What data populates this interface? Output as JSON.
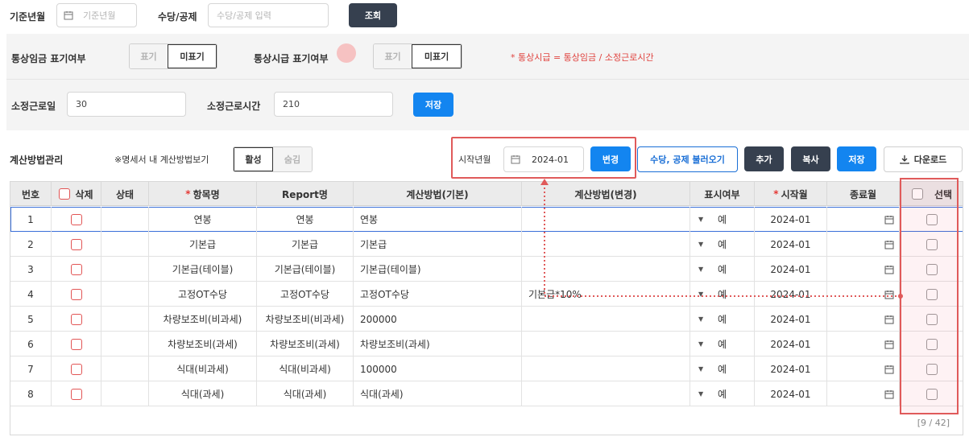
{
  "search": {
    "base_month_label": "기준년월",
    "base_month_placeholder": "기준년월",
    "allowance_label": "수당/공제",
    "allowance_placeholder": "수당/공제 입력",
    "search_button": "조회"
  },
  "display_options": {
    "normal_wage_label": "통상임금 표기여부",
    "normal_hourly_label": "통상시급 표기여부",
    "show": "표기",
    "hide": "미표기",
    "formula_note": "* 통상시급 = 통상임금 / 소정근로시간"
  },
  "work": {
    "days_label": "소정근로일",
    "days_value": "30",
    "hours_label": "소정근로시간",
    "hours_value": "210",
    "save_button": "저장"
  },
  "calc": {
    "section_label": "계산방법관리",
    "view_note": "※명세서 내 계산방법보기",
    "active": "활성",
    "hidden": "숨김",
    "start_month_label": "시작년월",
    "start_month_value": "2024-01",
    "change_button": "변경",
    "load_button": "수당, 공제 불러오기",
    "add_button": "추가",
    "copy_button": "복사",
    "save_button": "저장",
    "download_button": "다운로드"
  },
  "table": {
    "headers": {
      "no": "번호",
      "delete": "삭제",
      "status": "상태",
      "item": "항목명",
      "report": "Report명",
      "basic": "계산방법(기본)",
      "changed": "계산방법(변경)",
      "display": "표시여부",
      "start": "시작월",
      "end": "종료월",
      "select": "선택"
    },
    "rows": [
      {
        "no": "1",
        "item": "연봉",
        "report": "연봉",
        "basic": "연봉",
        "changed": "",
        "display": "예",
        "start": "2024-01"
      },
      {
        "no": "2",
        "item": "기본급",
        "report": "기본급",
        "basic": "기본급",
        "changed": "",
        "display": "예",
        "start": "2024-01"
      },
      {
        "no": "3",
        "item": "기본급(테이블)",
        "report": "기본급(테이블)",
        "basic": "기본급(테이블)",
        "changed": "",
        "display": "예",
        "start": "2024-01"
      },
      {
        "no": "4",
        "item": "고정OT수당",
        "report": "고정OT수당",
        "basic": "고정OT수당",
        "changed": "기본급*10%",
        "display": "예",
        "start": "2024-01"
      },
      {
        "no": "5",
        "item": "차량보조비(비과세)",
        "report": "차량보조비(비과세)",
        "basic": "200000",
        "changed": "",
        "display": "예",
        "start": "2024-01"
      },
      {
        "no": "6",
        "item": "차량보조비(과세)",
        "report": "차량보조비(과세)",
        "basic": "차량보조비(과세)",
        "changed": "",
        "display": "예",
        "start": "2024-01"
      },
      {
        "no": "7",
        "item": "식대(비과세)",
        "report": "식대(비과세)",
        "basic": "100000",
        "changed": "",
        "display": "예",
        "start": "2024-01"
      },
      {
        "no": "8",
        "item": "식대(과세)",
        "report": "식대(과세)",
        "basic": "식대(과세)",
        "changed": "",
        "display": "예",
        "start": "2024-01"
      }
    ],
    "pager": "[9 / 42]"
  },
  "colors": {
    "accent_blue": "#1385f0",
    "dark_button": "#36404f",
    "highlight_red": "#e05a5a",
    "required_red": "#e53935"
  },
  "icons": {
    "calendar": "calendar-icon",
    "download": "download-icon",
    "dropdown": "caret-down-icon"
  }
}
